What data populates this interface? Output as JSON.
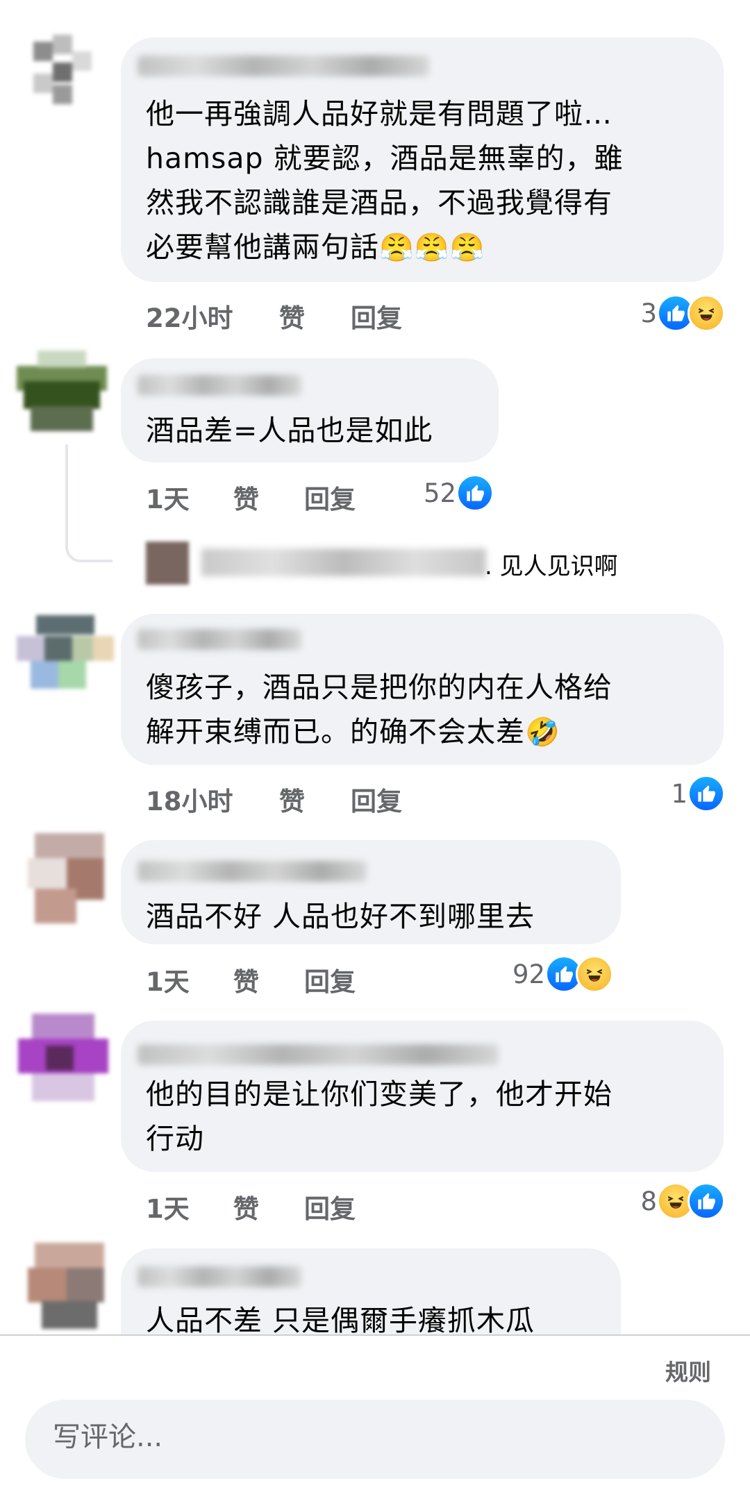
{
  "comments": [
    {
      "text": "他一再強調人品好就是有問題了啦…\nhamsap 就要認，酒品是無辜的，雖\n然我不認識誰是酒品，不過我覺得有\n必要幫他講兩句話",
      "emoji": "😤😤😤",
      "time": "22小时",
      "like": "赞",
      "reply": "回复",
      "reaction_count": "3",
      "reactions": [
        "like-icon",
        "haha-icon"
      ]
    },
    {
      "text": "酒品差=人品也是如此",
      "time": "1天",
      "like": "赞",
      "reply": "回复",
      "reaction_count": "52",
      "reactions": [
        "like-icon"
      ],
      "reply_preview": ". 见人见识啊"
    },
    {
      "text": "傻孩子，酒品只是把你的内在人格给\n解开束缚而已。的确不会太差",
      "emoji": "🤣",
      "time": "18小时",
      "like": "赞",
      "reply": "回复",
      "reaction_count": "1",
      "reactions": [
        "like-icon"
      ]
    },
    {
      "text": "酒品不好 人品也好不到哪里去",
      "time": "1天",
      "like": "赞",
      "reply": "回复",
      "reaction_count": "92",
      "reactions": [
        "like-icon",
        "haha-icon"
      ]
    },
    {
      "text": "他的目的是让你们变美了，他才开始\n行动",
      "time": "1天",
      "like": "赞",
      "reply": "回复",
      "reaction_count": "8",
      "reactions": [
        "haha-icon",
        "like-icon"
      ]
    },
    {
      "text": "人品不差 只是偶爾手癢抓木瓜"
    }
  ],
  "footer": {
    "rules": "规则",
    "composer_placeholder": "写评论..."
  },
  "colors": {
    "bubble": "#f0f2f5",
    "meta_text": "#65676b",
    "like_blue": "#0866ff",
    "haha_yellow": "#f7b125"
  }
}
